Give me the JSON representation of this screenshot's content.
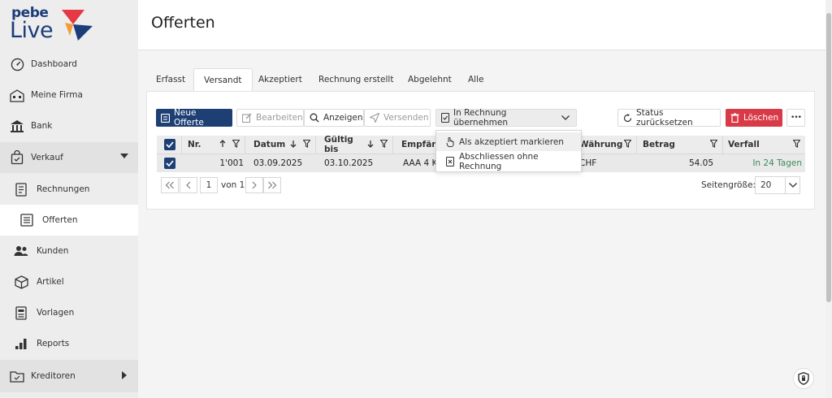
{
  "brand": {
    "line1": "pebe",
    "line2": "Live"
  },
  "sidebar": {
    "items": [
      {
        "label": "Dashboard",
        "icon": "dashboard-gauge-icon"
      },
      {
        "label": "Meine Firma",
        "icon": "building-icon"
      },
      {
        "label": "Bank",
        "icon": "bank-icon"
      },
      {
        "label": "Verkauf",
        "icon": "shopping-bag-icon"
      },
      {
        "label": "Rechnungen",
        "icon": "document-icon"
      },
      {
        "label": "Offerten",
        "icon": "document-list-icon"
      },
      {
        "label": "Kunden",
        "icon": "people-icon"
      },
      {
        "label": "Artikel",
        "icon": "box-icon"
      },
      {
        "label": "Vorlagen",
        "icon": "template-icon"
      },
      {
        "label": "Reports",
        "icon": "bar-chart-icon"
      },
      {
        "label": "Kreditoren",
        "icon": "folder-icon"
      }
    ]
  },
  "header": {
    "title": "Offerten"
  },
  "tabs": [
    "Erfasst",
    "Versandt",
    "Akzeptiert",
    "Rechnung erstellt",
    "Abgelehnt",
    "Alle"
  ],
  "toolbar": {
    "new": "Neue Offerte",
    "edit": "Bearbeiten",
    "view": "Anzeigen",
    "send": "Versenden",
    "to_invoice": "In Rechnung übernehmen",
    "reset": "Status zurücksetzen",
    "delete": "Löschen",
    "more": "•••"
  },
  "dropdown": {
    "items": [
      "Als akzeptiert markieren",
      "Abschliessen ohne Rechnung"
    ]
  },
  "table": {
    "columns": [
      "Nr.",
      "Datum",
      "Gültig bis",
      "Empfän",
      "Währung",
      "Betrag",
      "Verfall"
    ],
    "rows": [
      {
        "nr": "1'001",
        "datum": "03.09.2025",
        "gueltig": "03.10.2025",
        "empfaenger": "AAA 4 K",
        "waehrung": "CHF",
        "betrag": "54.05",
        "verfall": "In 24 Tagen"
      }
    ]
  },
  "pager": {
    "current": "1",
    "of": "von 1",
    "size_label": "Seitengröße:",
    "size_value": "20"
  },
  "colors": {
    "primary": "#1d3f74",
    "danger": "#d93a47",
    "verfall": "#3c8a5a"
  }
}
